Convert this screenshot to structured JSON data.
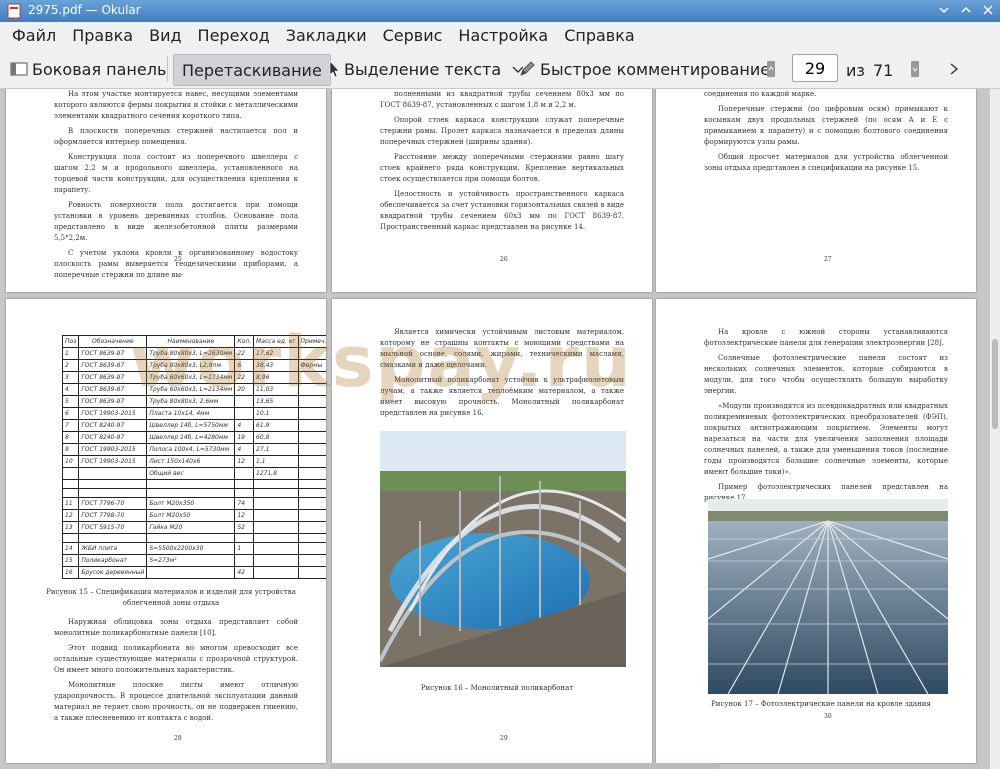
{
  "window": {
    "title": "2975.pdf — Okular"
  },
  "menu": [
    "Файл",
    "Правка",
    "Вид",
    "Переход",
    "Закладки",
    "Сервис",
    "Настройка",
    "Справка"
  ],
  "toolbar": {
    "sidebar_label": "Боковая панель",
    "drag_label": "Перетаскивание",
    "select_label": "Выделение текста",
    "comment_label": "Быстрое комментирование",
    "page_current": "29",
    "of_label": "из",
    "page_total": "71"
  },
  "watermark": "workspay.ru",
  "pages": {
    "p25": {
      "number": "25",
      "paras": [
        "На этом участке монтируется навес, несущими элементами которого являются фермы покрытия и стойки с металлическими элементами квадратного сечения короткого типа.",
        "В плоскости поперечных стержней настилается пол и оформляется интерьер помещения.",
        "Конструкция пола состоит из поперечного швеллера с шагом 2,2 м и продольного швеллера, установленного на торцевой части конструкции, для осуществления крепления к парапету.",
        "Ровность поверхности пола достигается при помощи установки в уровень деревянных столбов. Основание пола представлено в виде железобетонной плиты размерами 5,5*2,2м.",
        "С учетом уклона кровли к организованному водостоку плоскость рамы выверяется геодезическими приборами, а поперечные стержни по длине вы-"
      ]
    },
    "p26": {
      "number": "26",
      "paras": [
        "полненными из квадратной трубы сечением 80х3 мм по ГОСТ 8639-87, установленных с шагом 1,8 м и 2,2 м.",
        "Опорой стоек каркаса конструкции служат поперечные стержни рамы. Пролет каркаса назначается в пределах длины поперечных стержней (ширины здания).",
        "Расстояние между поперечными стержнями равно шагу стоек крайнего ряда конструкции. Крепление вертикальных стоек осуществляется при помощи болтов.",
        "Целостность и устойчивость пространственного каркаса обеспечивается за счет установки горизонтальных связей в виде квадратной трубы сечением 60х3 мм по ГОСТ 8639-87. Пространственный каркас представлен на рисунке 14."
      ]
    },
    "p27": {
      "number": "27",
      "paras": [
        "соединения по каждой марке.",
        "Поперечные стержни (по цифровым осям) примыкают к косынкам двух продольных стержней (по осям А и Е с примыканием к парапету) и с помощью болтового соединения формируются узлы рамы.",
        "Общий просчет материалов для устройства облегченной зоны отдыха представлен в спецификации на рисунке 15."
      ]
    },
    "p28": {
      "number": "28",
      "table_head": [
        "Поз",
        "Обозначение",
        "Наименование",
        "Кол.",
        "Масса ед. кг",
        "Примеч."
      ],
      "table_rows": [
        [
          "1",
          "ГОСТ 8639-87",
          "Труба 80х80х3, L=2630мм",
          "22",
          "17,62",
          ""
        ],
        [
          "2",
          "ГОСТ 8639-87",
          "Труба 80х80х3, L2,9пм",
          "6",
          "38,43",
          "Фермы"
        ],
        [
          "3",
          "ГОСТ 8639-87",
          "Труба 60х60х3, L=1734мм",
          "22",
          "8,96",
          ""
        ],
        [
          "4",
          "ГОСТ 8639-87",
          "Труба 60х60х3, L=2134мм",
          "20",
          "11,03",
          ""
        ],
        [
          "5",
          "ГОСТ 8639-87",
          "Труба 80х80х3, 2,6мм",
          "",
          "13,65",
          ""
        ],
        [
          "6",
          "ГОСТ 19903-2015",
          "Пласта 10х14, 4мм",
          "",
          "10,1",
          ""
        ],
        [
          "7",
          "ГОСТ 8240-97",
          "Швеллер 14б, L=5750мм",
          "4",
          "61,9",
          ""
        ],
        [
          "8",
          "ГОСТ 8240-97",
          "Швеллер 14б, L=4280мм",
          "19",
          "60,8",
          ""
        ],
        [
          "9",
          "ГОСТ 19903-2015",
          "Полоса 100х4, L=5730мм",
          "4",
          "27,1",
          ""
        ],
        [
          "10",
          "ГОСТ 19903-2015",
          "Лист 150х140х6",
          "12",
          "1,1",
          ""
        ],
        [
          "",
          "",
          "Общий вес",
          "",
          "1271,8",
          ""
        ],
        [
          "",
          "",
          "",
          "",
          "",
          ""
        ],
        [
          "",
          "",
          "",
          "",
          "",
          ""
        ],
        [
          "11",
          "ГОСТ 7796-70",
          "Болт М20х350",
          "74",
          "",
          ""
        ],
        [
          "12",
          "ГОСТ 7798-70",
          "Болт М20х50",
          "12",
          "",
          ""
        ],
        [
          "13",
          "ГОСТ 5915-70",
          "Гайка М20",
          "52",
          "",
          ""
        ],
        [
          "",
          "",
          "",
          "",
          "",
          ""
        ],
        [
          "14",
          "ЖБИ плита",
          "S=5500х2200х30",
          "1",
          "",
          ""
        ],
        [
          "15",
          "Поликарбонат",
          "S=273м²",
          "",
          "",
          ""
        ],
        [
          "16",
          "Брусок деревянный",
          "",
          "42",
          "",
          ""
        ]
      ],
      "caption": "Рисунок 15 – Спецификация материалов и изделий для устройства облегченной зоны отдыха",
      "paras": [
        "Наружная облицовка зоны отдыха представляет собой монолитные поликарбонатные панели [10].",
        "Этот подвид поликарбоната во многом превосходит все остальные существующие материалы с прозрачной структурой. Он имеет много положительных характеристик.",
        "Монолитные плоские листы имеют отличную ударопрочность. В процессе длительной эксплуатации данный материал не теряет свою прочность, он не подвержен гниению, а также плесневению от контакта с водой."
      ]
    },
    "p29": {
      "number": "29",
      "paras": [
        "Является химически устойчивым листовым материалом, которому не страшны контакты с моющими средствами на мыльной основе, солями, жирами, техническими маслами, смазками и даже щелочами.",
        "Монолитный поликарбонат устойчив к ультрафиолетовым лучам, а также является теплоёмким материалом, а также имеет высокую прочность. Монолитный поликарбонат представлен на рисунке 16."
      ],
      "caption": "Рисунок 16 – Монолитный поликарбонат"
    },
    "p30": {
      "number": "30",
      "paras": [
        "На кровле с южной стороны устанавливаются фотоэлектрические панели для генерации электроэнергии [28].",
        "Солнечные фотоэлектрические панели состоят из нескольких солнечных элементов, которые собираются в модули, для того чтобы осуществлять большую выработку энергии.",
        "«Модули производятся из псевдоквадратных или квадратных поликремниевых фотоэлектрических преобразователей (ФЭП), покрытых антиотражающим покрытием. Элементы могут нарезаться на части для увеличения заполнения площади солнечных панелей, а также для уменьшения токов (последние годы производятся большие солнечные элементы, которые имеют большие токи)».",
        "Пример фотоэлектрических панелей представлен на рисунке 17."
      ],
      "caption": "Рисунок 17 – Фотоэлектрические панели на кровле здания"
    }
  },
  "colors": {
    "titlebar": "#3f7fc0",
    "toolbar": "#eff0f1",
    "viewer_bg": "#c7c7c7",
    "watermark": "#a06414"
  }
}
